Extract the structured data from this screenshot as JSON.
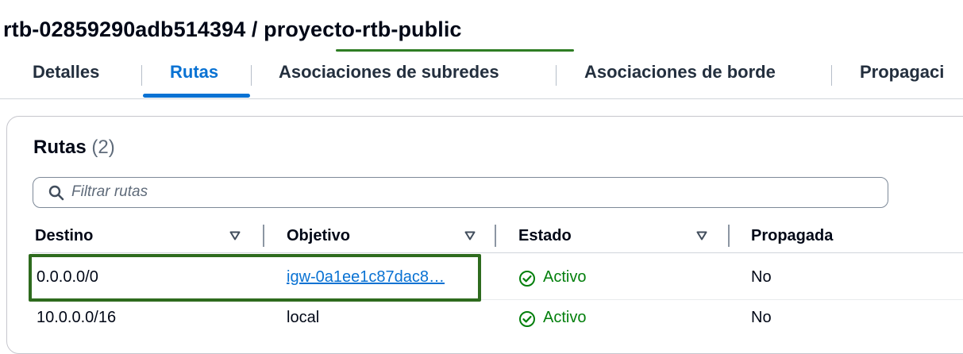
{
  "header": {
    "route_table_id": "rtb-02859290adb514394",
    "separator": "/",
    "route_table_name": "proyecto-rtb-public"
  },
  "tabs": [
    {
      "label": "Detalles",
      "active": false
    },
    {
      "label": "Rutas",
      "active": true
    },
    {
      "label": "Asociaciones de subredes",
      "active": false
    },
    {
      "label": "Asociaciones de borde",
      "active": false
    },
    {
      "label": "Propagaci",
      "active": false
    }
  ],
  "routes": {
    "title": "Rutas",
    "count": "(2)",
    "search": {
      "placeholder": "Filtrar rutas",
      "icon": "search-icon"
    },
    "columns": [
      "Destino",
      "Objetivo",
      "Estado",
      "Propagada"
    ],
    "rows": [
      {
        "destino": "0.0.0.0/0",
        "objetivo": "igw-0a1ee1c87dac8…",
        "objetivo_is_link": true,
        "estado": "Activo",
        "propagada": "No"
      },
      {
        "destino": "10.0.0.0/16",
        "objetivo": "local",
        "objetivo_is_link": false,
        "estado": "Activo",
        "propagada": "No"
      }
    ]
  },
  "colors": {
    "accent": "#0972d3",
    "status_active": "#037f0c",
    "annotation_green": "#2e6b1e",
    "text": "#000716"
  }
}
